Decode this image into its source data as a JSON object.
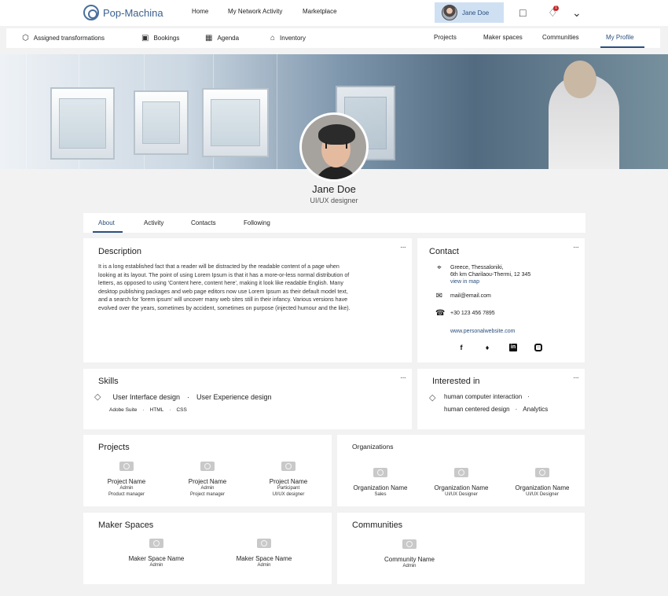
{
  "brand": {
    "name": "Pop-Machina"
  },
  "topnav": {
    "home": "Home",
    "network": "My Network Activity",
    "marketplace": "Marketplace"
  },
  "user": {
    "name": "Jane Doe"
  },
  "notifications": {
    "count": "1"
  },
  "icons": {
    "chat": "chat-icon",
    "bell": "bell-icon",
    "chevron": "chevron-down-icon"
  },
  "subnav": {
    "left": [
      {
        "label": "Assigned transformations",
        "icon": "cube-icon"
      },
      {
        "label": "Bookings",
        "icon": "calendar-check-icon"
      },
      {
        "label": "Agenda",
        "icon": "calendar-icon"
      },
      {
        "label": "Inventory",
        "icon": "inventory-icon"
      }
    ],
    "right": [
      "Projects",
      "Maker spaces",
      "Communities",
      "My Profile"
    ]
  },
  "profile": {
    "name": "Jane Doe",
    "title": "UI/UX designer"
  },
  "tabs": [
    "About",
    "Activity",
    "Contacts",
    "Following"
  ],
  "description": {
    "title": "Description",
    "text": "It is a long established fact that a reader will be distracted by the readable content of a page when looking at its layout. The point of using Lorem Ipsum is that it has a more-or-less normal distribution of letters, as opposed to using 'Content here, content here', making it look like readable English. Many desktop publishing packages and web page editors now use Lorem Ipsum as their default model text, and a search for 'lorem ipsum' will uncover many web sites still in their infancy. Various versions have evolved over the years, sometimes by accident, sometimes on purpose (injected humour and the like)."
  },
  "contact": {
    "title": "Contact",
    "address_line1": "Greece, Thessaloniki,",
    "address_line2": "6th km Charilaou-Thermi, 12 345",
    "map_link": "view in map",
    "email": "mail@email.com",
    "phone": "+30 123 456 7895",
    "website": "www.personalwebsite.com",
    "social": [
      "facebook-icon",
      "twitter-icon",
      "linkedin-icon",
      "instagram-icon"
    ]
  },
  "skills": {
    "title": "Skills",
    "main": [
      "User Interface design",
      "User Experience design"
    ],
    "sub": [
      "Adobe Suite",
      "HTML",
      "CSS"
    ]
  },
  "interests": {
    "title": "Interested in",
    "items": [
      "human computer interaction",
      "human centered design",
      "Analytics"
    ]
  },
  "projects": {
    "title": "Projects",
    "items": [
      {
        "name": "Project Name",
        "role1": "Admin",
        "role2": "Product manager"
      },
      {
        "name": "Project Name",
        "role1": "Admin",
        "role2": "Project manager"
      },
      {
        "name": "Project Name",
        "role1": "Participant",
        "role2": "UI/UX designer"
      }
    ]
  },
  "organizations": {
    "title": "Organizations",
    "items": [
      {
        "name": "Organization Name",
        "role": "Sales"
      },
      {
        "name": "Organization Name",
        "role": "UI/UX Designer"
      },
      {
        "name": "Organization Name",
        "role": "UI/UX Designer"
      }
    ]
  },
  "maker_spaces": {
    "title": "Maker Spaces",
    "items": [
      {
        "name": "Maker Space Name",
        "role": "Admin"
      },
      {
        "name": "Maker Space Name",
        "role": "Admin"
      }
    ]
  },
  "communities": {
    "title": "Communities",
    "items": [
      {
        "name": "Community Name",
        "role": "Admin"
      }
    ]
  }
}
